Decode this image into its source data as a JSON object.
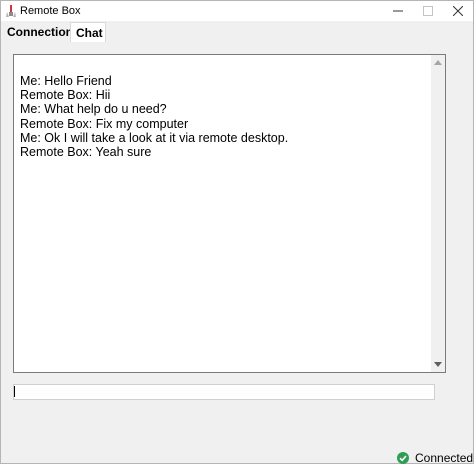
{
  "window": {
    "title": "Remote Box"
  },
  "tabs": [
    {
      "label": "Connection"
    },
    {
      "label": "Chat"
    }
  ],
  "chat": {
    "messages": [
      "Me: Hello Friend",
      "Remote Box: Hii",
      "Me: What help do u need?",
      "Remote Box: Fix my computer",
      "Me: Ok I will take a look at it via remote desktop.",
      "Remote Box: Yeah sure"
    ],
    "input_value": ""
  },
  "status": {
    "text": "Connected",
    "icon": "check-circle-icon",
    "color": "#2e9e57"
  },
  "colors": {
    "app_icon": "#d6333b",
    "window_bg": "#f0f0f0"
  }
}
